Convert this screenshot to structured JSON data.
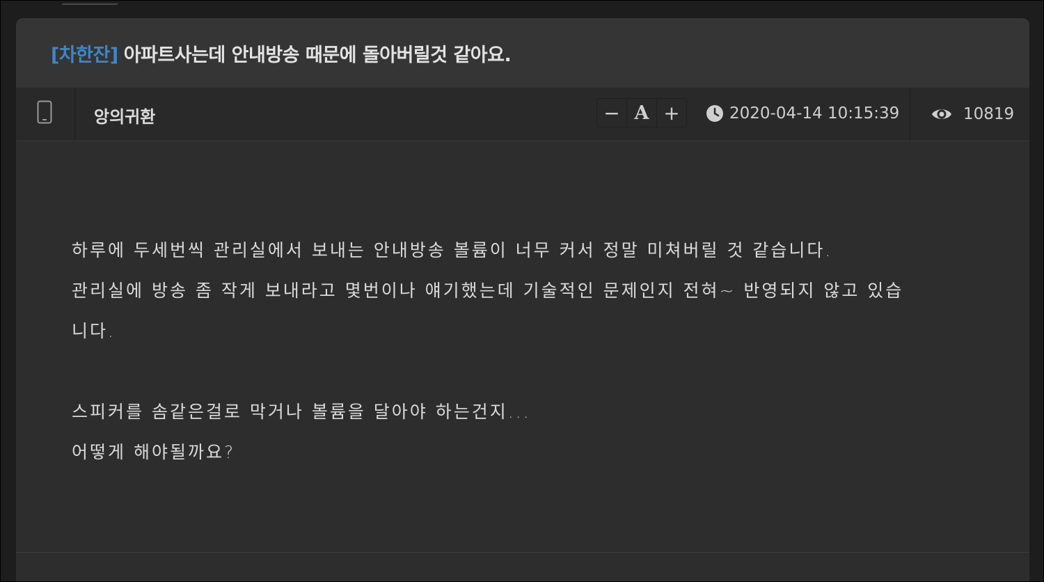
{
  "post": {
    "category": "[차한잔]",
    "title": "아파트사는데 안내방송 때문에 돌아버릴것 같아요.",
    "author": "앙의귀환",
    "datetime": "2020-04-14 10:15:39",
    "views": "10819",
    "font_controls": {
      "decrease": "−",
      "font": "A",
      "increase": "+"
    },
    "body": {
      "line1": "하루에 두세번씩 관리실에서 보내는 안내방송 볼륨이 너무 커서 정말 미쳐버릴 것 같습니다.",
      "line2": "관리실에 방송 좀 작게 보내라고 몇번이나 얘기했는데 기술적인 문제인지 전혀~ 반영되지 않고 있습",
      "line3": "니다.",
      "line4": "스피커를 솜같은걸로 막거나 볼륨을 달아야 하는건지...",
      "line5": "어떻게 해야될까요?"
    }
  },
  "icons": {
    "device": "mobile-phone-icon",
    "clock": "clock-icon",
    "views": "eye-icon"
  },
  "colors": {
    "category": "#3f86c6",
    "background": "#2d2d2d",
    "header": "#353535"
  }
}
